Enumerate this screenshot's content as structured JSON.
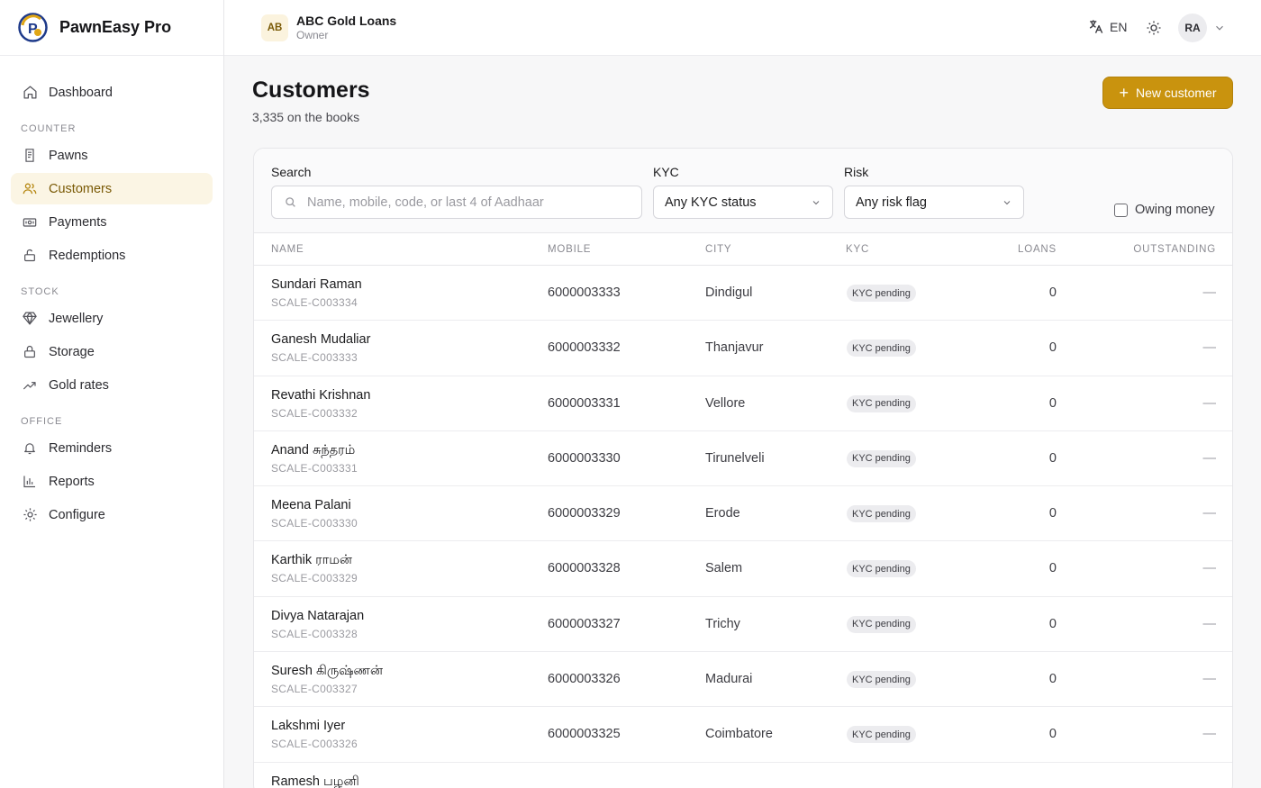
{
  "brand": {
    "name": "PawnEasy Pro"
  },
  "org": {
    "initials": "AB",
    "name": "ABC Gold Loans",
    "role": "Owner"
  },
  "header": {
    "language": "EN",
    "user_initials": "RA"
  },
  "sidebar": {
    "top": [
      {
        "label": "Dashboard",
        "icon": "home-icon"
      }
    ],
    "sections": [
      {
        "title": "COUNTER",
        "items": [
          {
            "label": "Pawns",
            "icon": "receipt-icon"
          },
          {
            "label": "Customers",
            "icon": "users-icon",
            "active": true
          },
          {
            "label": "Payments",
            "icon": "banknote-icon"
          },
          {
            "label": "Redemptions",
            "icon": "unlock-icon"
          }
        ]
      },
      {
        "title": "STOCK",
        "items": [
          {
            "label": "Jewellery",
            "icon": "gem-icon"
          },
          {
            "label": "Storage",
            "icon": "lock-icon"
          },
          {
            "label": "Gold rates",
            "icon": "trending-up-icon"
          }
        ]
      },
      {
        "title": "OFFICE",
        "items": [
          {
            "label": "Reminders",
            "icon": "bell-icon"
          },
          {
            "label": "Reports",
            "icon": "bar-chart-icon"
          },
          {
            "label": "Configure",
            "icon": "settings-icon"
          }
        ]
      }
    ]
  },
  "page": {
    "title": "Customers",
    "subtitle": "3,335 on the books",
    "new_button_label": "New customer"
  },
  "filters": {
    "search_label": "Search",
    "search_placeholder": "Name, mobile, code, or last 4 of Aadhaar",
    "kyc_label": "KYC",
    "kyc_value": "Any KYC status",
    "risk_label": "Risk",
    "risk_value": "Any risk flag",
    "owing_label": "Owing money"
  },
  "table": {
    "columns": [
      "NAME",
      "MOBILE",
      "CITY",
      "KYC",
      "LOANS",
      "OUTSTANDING"
    ],
    "rows": [
      {
        "name": "Sundari Raman",
        "code": "SCALE-C003334",
        "mobile": "6000003333",
        "city": "Dindigul",
        "kyc": "KYC pending",
        "loans": "0",
        "outstanding": "—"
      },
      {
        "name": "Ganesh Mudaliar",
        "code": "SCALE-C003333",
        "mobile": "6000003332",
        "city": "Thanjavur",
        "kyc": "KYC pending",
        "loans": "0",
        "outstanding": "—"
      },
      {
        "name": "Revathi Krishnan",
        "code": "SCALE-C003332",
        "mobile": "6000003331",
        "city": "Vellore",
        "kyc": "KYC pending",
        "loans": "0",
        "outstanding": "—"
      },
      {
        "name": "Anand சுந்தரம்",
        "code": "SCALE-C003331",
        "mobile": "6000003330",
        "city": "Tirunelveli",
        "kyc": "KYC pending",
        "loans": "0",
        "outstanding": "—"
      },
      {
        "name": "Meena Palani",
        "code": "SCALE-C003330",
        "mobile": "6000003329",
        "city": "Erode",
        "kyc": "KYC pending",
        "loans": "0",
        "outstanding": "—"
      },
      {
        "name": "Karthik ராமன்",
        "code": "SCALE-C003329",
        "mobile": "6000003328",
        "city": "Salem",
        "kyc": "KYC pending",
        "loans": "0",
        "outstanding": "—"
      },
      {
        "name": "Divya Natarajan",
        "code": "SCALE-C003328",
        "mobile": "6000003327",
        "city": "Trichy",
        "kyc": "KYC pending",
        "loans": "0",
        "outstanding": "—"
      },
      {
        "name": "Suresh கிருஷ்ணன்",
        "code": "SCALE-C003327",
        "mobile": "6000003326",
        "city": "Madurai",
        "kyc": "KYC pending",
        "loans": "0",
        "outstanding": "—"
      },
      {
        "name": "Lakshmi Iyer",
        "code": "SCALE-C003326",
        "mobile": "6000003325",
        "city": "Coimbatore",
        "kyc": "KYC pending",
        "loans": "0",
        "outstanding": "—"
      },
      {
        "name": "Ramesh பழனி",
        "code": "",
        "mobile": "",
        "city": "",
        "kyc": "",
        "loans": "",
        "outstanding": ""
      }
    ]
  },
  "colors": {
    "accent": "#c9930e",
    "active_bg": "#fbf5e4",
    "active_text": "#7a5a06"
  }
}
